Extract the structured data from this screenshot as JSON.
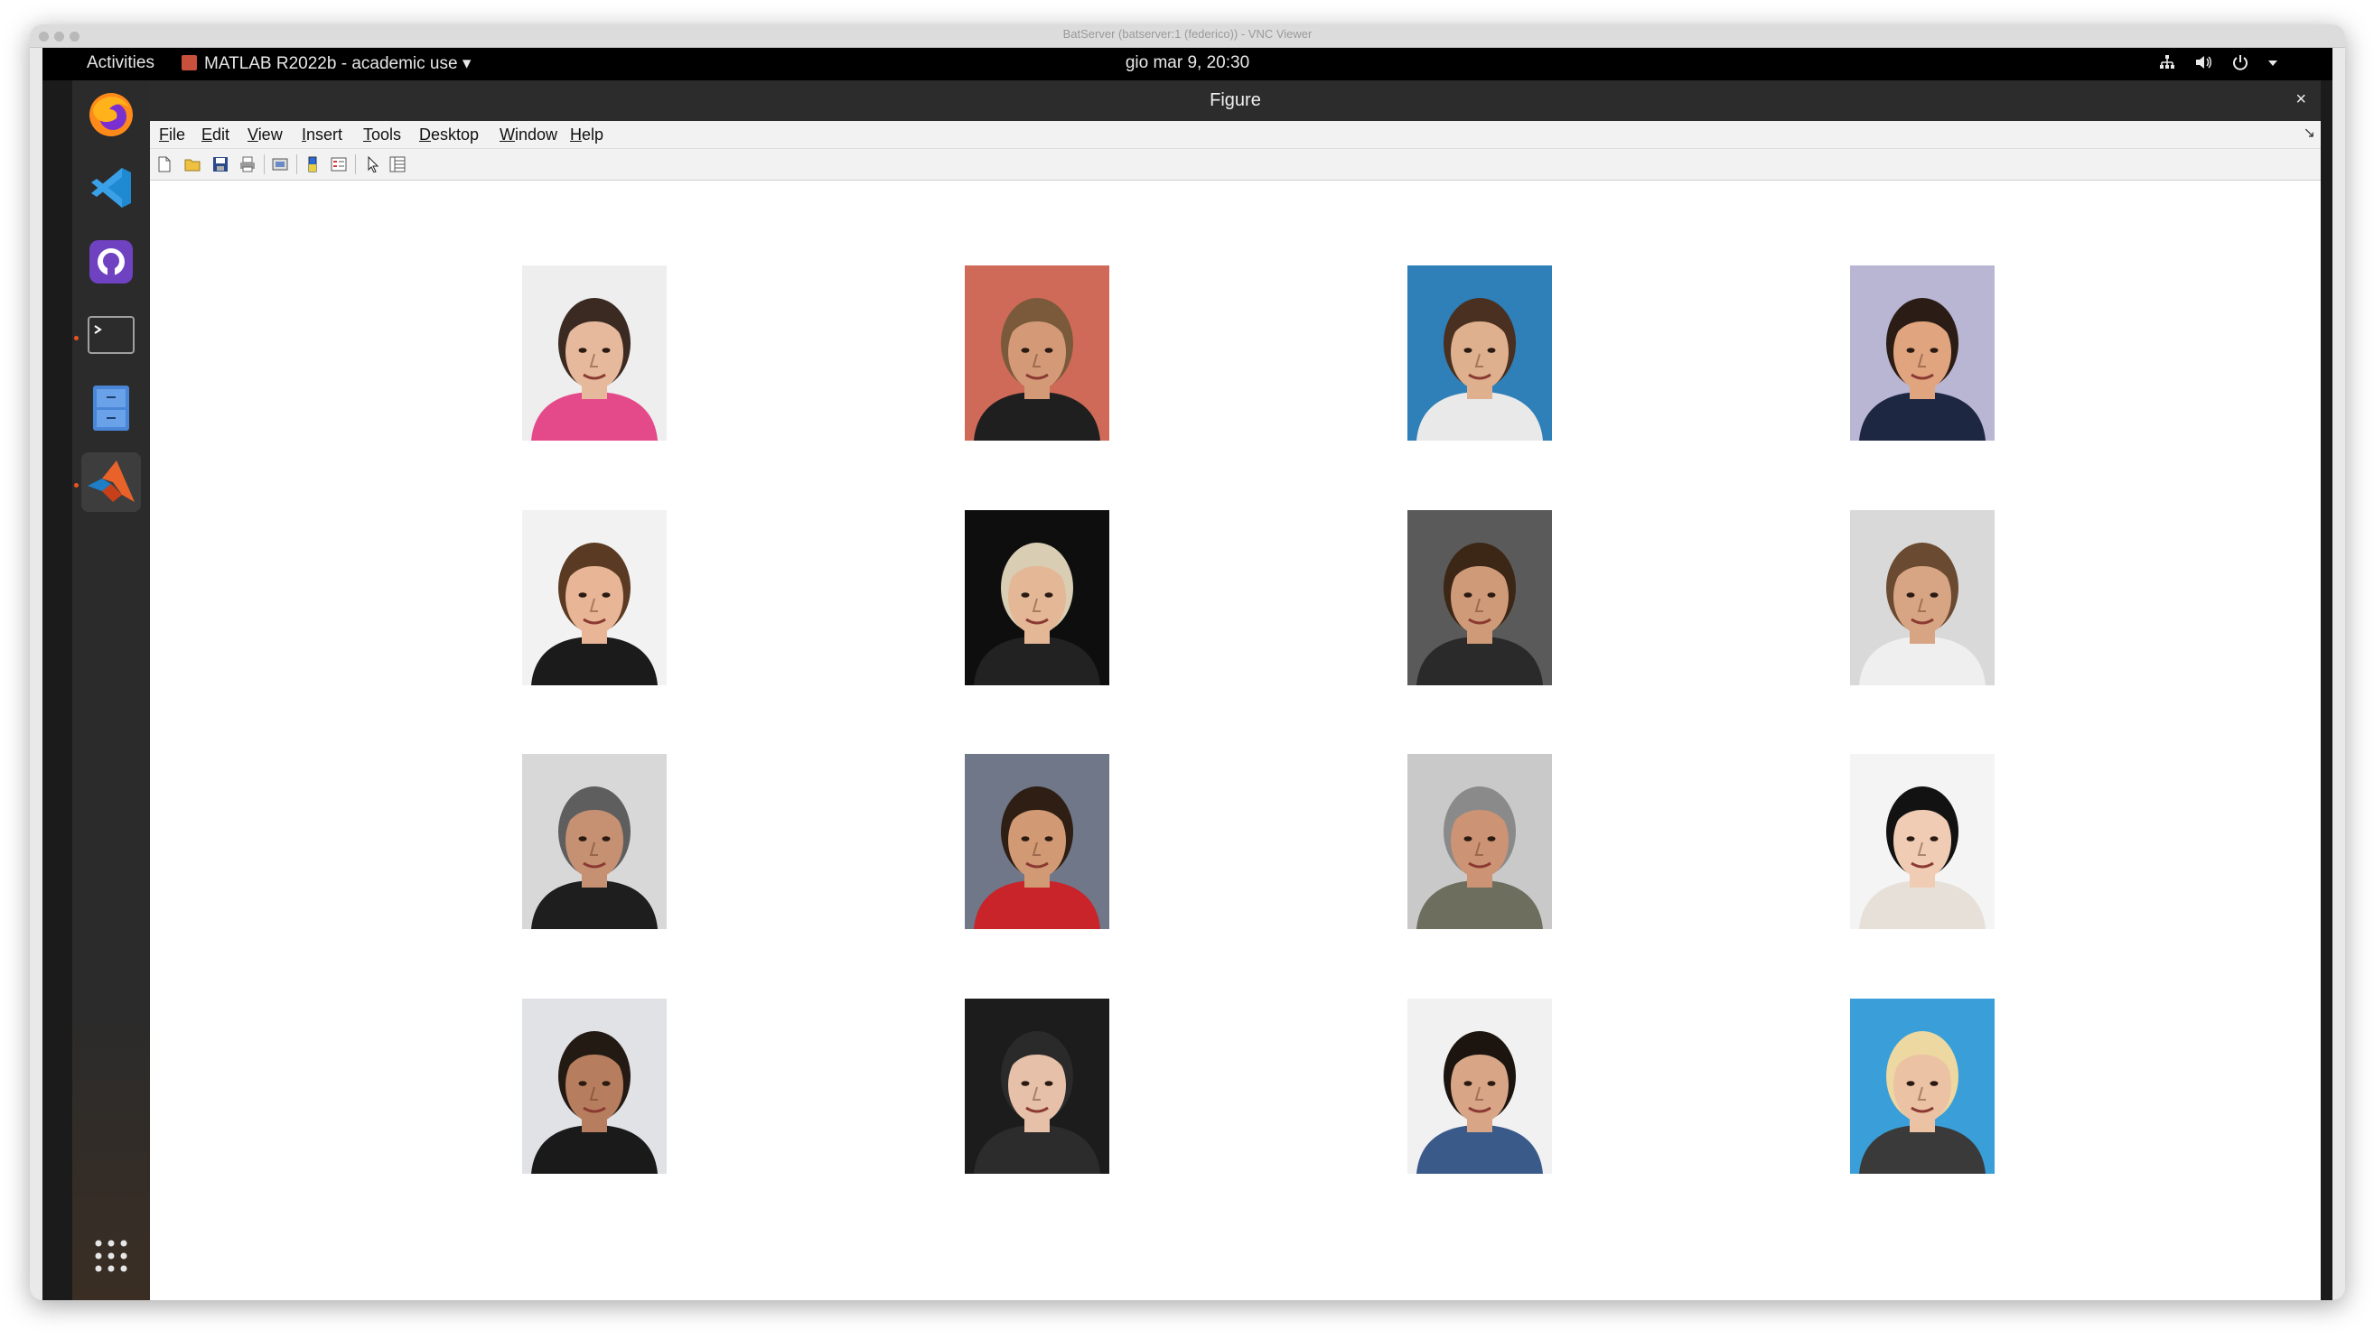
{
  "vnc": {
    "window_title": "BatServer (batserver:1 (federico)) - VNC Viewer"
  },
  "topbar": {
    "activities": "Activities",
    "app_menu": "MATLAB R2022b - academic use ▾",
    "clock": "gio mar  9, 20:30",
    "status_icons": [
      "network-icon",
      "volume-icon",
      "power-icon",
      "chevron-down-icon"
    ]
  },
  "dock": {
    "items": [
      "firefox-icon",
      "vscode-icon",
      "github-desktop-icon",
      "terminal-icon",
      "file-cabinet-icon",
      "matlab-icon"
    ],
    "show_apps": "app-grid-icon"
  },
  "figure": {
    "title": "Figure",
    "close": "×",
    "menu": {
      "file": "File",
      "edit": "Edit",
      "view": "View",
      "insert": "Insert",
      "tools": "Tools",
      "desktop": "Desktop",
      "window": "Window",
      "help": "Help"
    },
    "undock": "↘",
    "toolbar": [
      "new-figure-icon",
      "open-file-icon",
      "save-icon",
      "print-icon",
      "link-plot-icon",
      "insert-colorbar-icon",
      "insert-legend-icon",
      "edit-plot-icon",
      "property-inspector-icon"
    ],
    "grid": {
      "rows": 4,
      "cols": 4
    },
    "faces": [
      {
        "bg": "#eeeeee",
        "skin": "#e7b99c",
        "hair": "#3b2a22",
        "shirt": "#e44a8a"
      },
      {
        "bg": "#cf6a58",
        "skin": "#d49a78",
        "hair": "#7a5a3a",
        "shirt": "#1f1f1f"
      },
      {
        "bg": "#2f7fb8",
        "skin": "#deb08e",
        "hair": "#4a3020",
        "shirt": "#e9e9e9"
      },
      {
        "bg": "#b9b6d4",
        "skin": "#e0a47e",
        "hair": "#2b1d16",
        "shirt": "#1e2742"
      },
      {
        "bg": "#f2f2f2",
        "skin": "#e8b596",
        "hair": "#5a3a22",
        "shirt": "#1b1b1b"
      },
      {
        "bg": "#0e0e0e",
        "skin": "#e4b896",
        "hair": "#d9cdb4",
        "shirt": "#222222"
      },
      {
        "bg": "#5a5a5a",
        "skin": "#cf9a78",
        "hair": "#3c2616",
        "shirt": "#2a2a2a"
      },
      {
        "bg": "#d9d9d9",
        "skin": "#d8a584",
        "hair": "#6a4a30",
        "shirt": "#efefef"
      },
      {
        "bg": "#d8d8d8",
        "skin": "#c69072",
        "hair": "#5e5e5e",
        "shirt": "#1e1e1e"
      },
      {
        "bg": "#6f7788",
        "skin": "#d29a74",
        "hair": "#2e1e14",
        "shirt": "#c8242a"
      },
      {
        "bg": "#c9c9c9",
        "skin": "#cc9474",
        "hair": "#8a8a8a",
        "shirt": "#6e6e5e"
      },
      {
        "bg": "#f4f4f4",
        "skin": "#f0ccb4",
        "hair": "#121212",
        "shirt": "#e6e0d8"
      },
      {
        "bg": "#e0e2e6",
        "skin": "#b67e5e",
        "hair": "#241a14",
        "shirt": "#1a1a1a"
      },
      {
        "bg": "#1c1c1c",
        "skin": "#e6c0a8",
        "hair": "#2a2a2a",
        "shirt": "#2c2c2c"
      },
      {
        "bg": "#f1f1f1",
        "skin": "#d8a686",
        "hair": "#1c140e",
        "shirt": "#3a5a8a"
      },
      {
        "bg": "#3a9fd8",
        "skin": "#ecc2a4",
        "hair": "#ecd8a0",
        "shirt": "#3a3a3a"
      }
    ]
  }
}
